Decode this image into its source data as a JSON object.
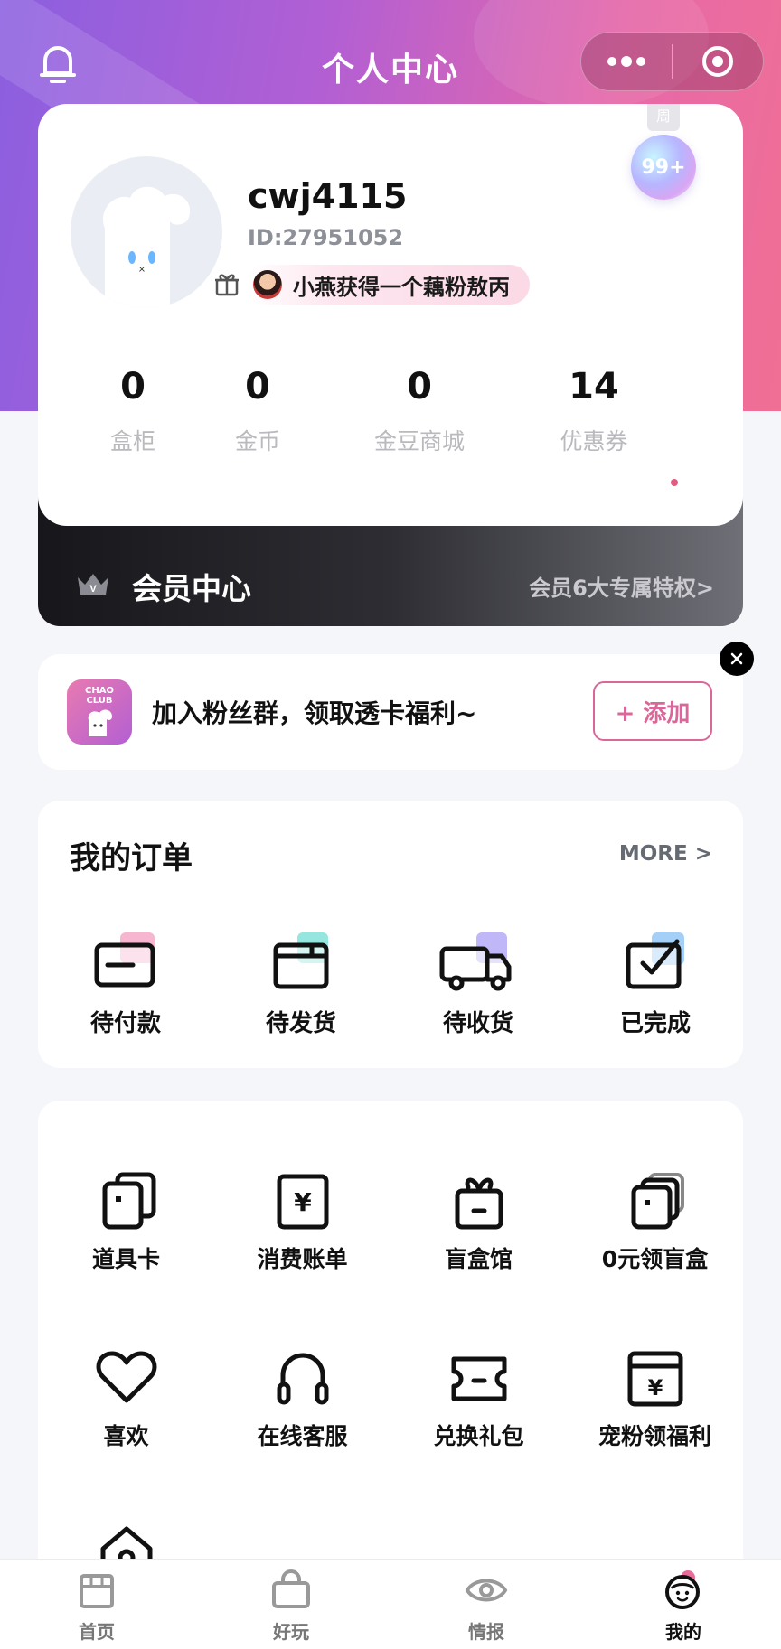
{
  "header": {
    "title": "个人中心"
  },
  "profile": {
    "username": "cwj4115",
    "user_id": "ID:27951052",
    "notice": "小燕获得一个藕粉敖丙",
    "week_badge": {
      "tab": "周",
      "count": "99+"
    },
    "stats": [
      {
        "value": "0",
        "label": "盒柜"
      },
      {
        "value": "0",
        "label": "金币"
      },
      {
        "value": "0",
        "label": "金豆商城"
      },
      {
        "value": "14",
        "label": "优惠券"
      }
    ]
  },
  "membership": {
    "title": "会员中心",
    "link": "会员6大专属特权>"
  },
  "fans": {
    "logo_text_1": "CHAO",
    "logo_text_2": "CLUB",
    "text": "加入粉丝群，领取透卡福利~",
    "button": "+ 添加"
  },
  "orders": {
    "title": "我的订单",
    "more": "MORE >",
    "items": [
      {
        "label": "待付款",
        "icon": "wallet-icon",
        "accent": "#f07aa8"
      },
      {
        "label": "待发货",
        "icon": "package-icon",
        "accent": "#4fd6c8"
      },
      {
        "label": "待收货",
        "icon": "truck-icon",
        "accent": "#8b7cf0"
      },
      {
        "label": "已完成",
        "icon": "check-box-icon",
        "accent": "#5aa8f0"
      }
    ]
  },
  "services": [
    {
      "label": "道具卡",
      "icon": "card-stack-icon"
    },
    {
      "label": "消费账单",
      "icon": "bill-icon"
    },
    {
      "label": "盲盒馆",
      "icon": "gift-box-icon"
    },
    {
      "label": "0元领盲盒",
      "icon": "free-box-icon"
    },
    {
      "label": "喜欢",
      "icon": "heart-icon"
    },
    {
      "label": "在线客服",
      "icon": "headphones-icon"
    },
    {
      "label": "兑换礼包",
      "icon": "ticket-icon"
    },
    {
      "label": "宠粉领福利",
      "icon": "welfare-icon"
    }
  ],
  "tabbar": [
    {
      "label": "首页",
      "icon": "store-icon",
      "active": false
    },
    {
      "label": "好玩",
      "icon": "bag-icon",
      "active": false
    },
    {
      "label": "情报",
      "icon": "eye-icon",
      "active": false
    },
    {
      "label": "我的",
      "icon": "mascot-icon",
      "active": true
    }
  ],
  "colors": {
    "accent_pink": "#d9679a",
    "gradient_start": "#8b5fe0",
    "gradient_end": "#f06f94"
  }
}
